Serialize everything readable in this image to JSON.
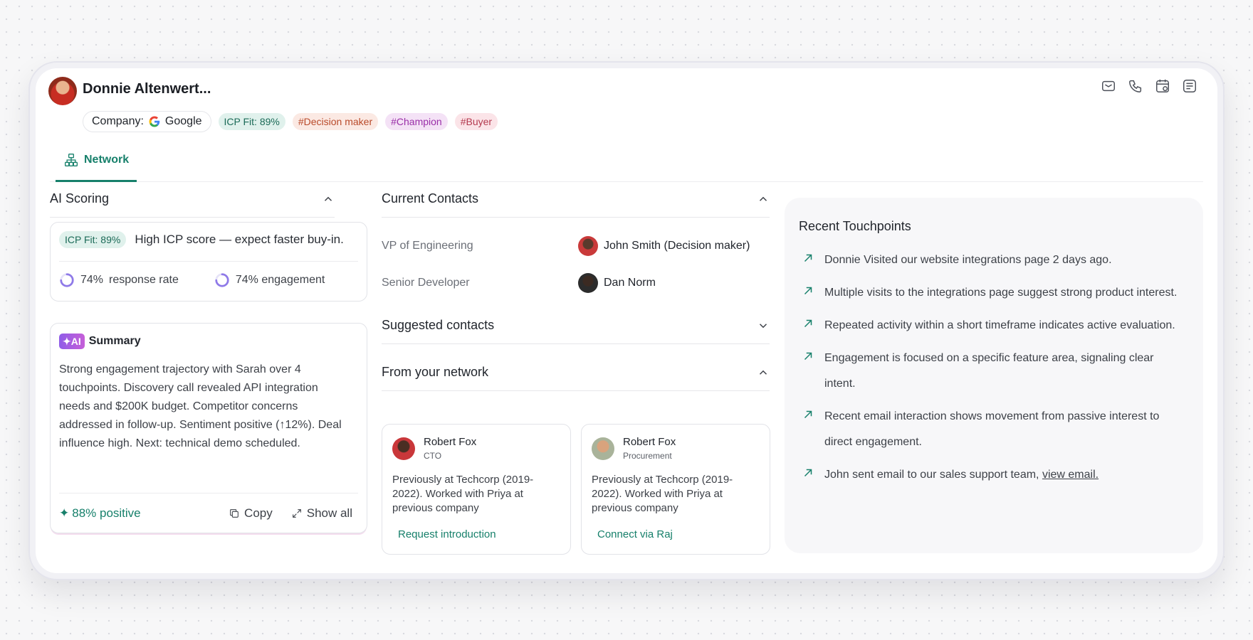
{
  "contact": {
    "name": "Donnie Altenwert...",
    "company_label": "Company:",
    "company_name": "Google",
    "tags": [
      "ICP Fit: 89%",
      "#Decision maker",
      "#Champion",
      "#Buyer"
    ]
  },
  "header_icons": [
    "mail-icon",
    "phone-icon",
    "calendar-icon",
    "notes-icon"
  ],
  "tabs": [
    {
      "label": "Network",
      "active": true
    }
  ],
  "ai_scoring": {
    "title": "AI Scoring",
    "icp_badge": "ICP Fit: 89%",
    "icp_text": "High ICP score — expect faster buy-in.",
    "metrics": [
      {
        "value": "74%",
        "label": "response rate",
        "fraction": 0.74
      },
      {
        "value": "74% engagement",
        "label": "",
        "fraction": 0.74
      }
    ]
  },
  "summary": {
    "badge": "✦AI",
    "title": "Summary",
    "text": "Strong engagement trajectory with Sarah over 4 touchpoints. Discovery call revealed API integration needs and $200K budget. Competitor concerns addressed in follow-up. Sentiment positive (↑12%). Deal influence high. Next: technical demo scheduled.",
    "sentiment": "88% positive",
    "copy_label": "Copy",
    "show_all_label": "Show all"
  },
  "current_contacts": {
    "title": "Current Contacts",
    "rows": [
      {
        "role": "VP of Engineering",
        "person": "John Smith (Decision maker)"
      },
      {
        "role": "Senior Developer",
        "person": "Dan Norm"
      }
    ]
  },
  "suggested_contacts": {
    "title": "Suggested contacts"
  },
  "network": {
    "title": "From your network",
    "cards": [
      {
        "name": "Robert Fox",
        "title": "CTO",
        "desc": "Previously at Techcorp (2019-2022). Worked with Priya at previous company",
        "action": "Request introduction"
      },
      {
        "name": "Robert Fox",
        "title": "Procurement",
        "desc": "Previously at Techcorp (2019-2022). Worked with Priya at previous company",
        "action": "Connect via Raj"
      }
    ]
  },
  "touchpoints": {
    "title": "Recent Touchpoints",
    "items": [
      "Donnie Visited our website integrations page 2 days ago.",
      "Multiple visits to the integrations page suggest strong product interest.",
      "Repeated activity within a short timeframe indicates active evaluation.",
      "Engagement is focused on a specific feature area, signaling clear intent.",
      "Recent email interaction shows movement from passive interest to direct engagement."
    ],
    "last_item_text": "John sent email to our sales support team, ",
    "last_item_link": "view email."
  },
  "colors": {
    "accent": "#17806b",
    "ring": "#8f7ae8"
  }
}
